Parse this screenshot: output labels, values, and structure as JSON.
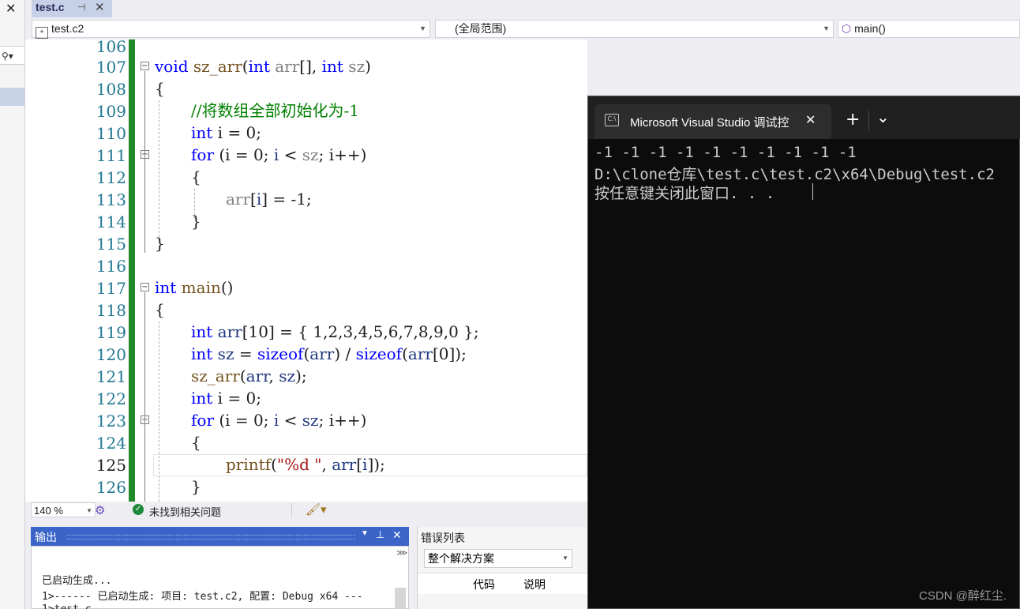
{
  "tabs": [
    {
      "name": "test.c",
      "pin": "⊣",
      "close": "✕"
    }
  ],
  "left_panel": {
    "close": "✕",
    "search_icon": "⚲▾"
  },
  "nav": {
    "project": "test.c2",
    "scope": "(全局范围)",
    "member": "main()"
  },
  "line_numbers": [
    "106",
    "107",
    "108",
    "109",
    "110",
    "111",
    "112",
    "113",
    "114",
    "115",
    "116",
    "117",
    "118",
    "119",
    "120",
    "121",
    "122",
    "123",
    "124",
    "125",
    "126"
  ],
  "code": {
    "l107": [
      "void",
      " sz_arr",
      "(",
      "int",
      " arr",
      "[], ",
      "int",
      " sz",
      ")"
    ],
    "l108": "{",
    "l109": "//将数组全部初始化为-1",
    "l110": [
      "int",
      " i = 0;"
    ],
    "l111": [
      "for",
      " (i = 0; ",
      "i",
      " < ",
      "sz",
      "; ",
      "i",
      "++)"
    ],
    "l112": "{",
    "l113": [
      "arr",
      "[",
      "i",
      "] = -1;"
    ],
    "l114": "}",
    "l115": "}",
    "l117": [
      "int",
      " main",
      "()"
    ],
    "l118": "{",
    "l119": [
      "int",
      " arr",
      "[10] = { 1,2,3,4,5,6,7,8,9,0 };"
    ],
    "l120": [
      "int",
      " sz",
      " = ",
      "sizeof",
      "(",
      "arr",
      ") / ",
      "sizeof",
      "(",
      "arr",
      "[0]);"
    ],
    "l121": [
      "sz_arr",
      "(",
      "arr",
      ", ",
      "sz",
      ");"
    ],
    "l122": [
      "int",
      " i = 0;"
    ],
    "l123": [
      "for",
      " (i = 0; ",
      "i",
      " < ",
      "sz",
      "; ",
      "i",
      "++)"
    ],
    "l124": "{",
    "l125": [
      "printf",
      "(",
      "\"%d \"",
      ", ",
      "arr",
      "[",
      "i",
      "]);"
    ],
    "l126": "}"
  },
  "status": {
    "zoom": "140 %",
    "issues": "未找到相关问题"
  },
  "output_panel": {
    "title": "输出",
    "lines": [
      "已启动生成...",
      "1>------ 已启动生成: 项目: test.c2, 配置: Debug x64 ---",
      "1>test.c"
    ]
  },
  "error_panel": {
    "title": "错误列表",
    "scope": "整个解决方案",
    "col_code": "代码",
    "col_desc": "说明"
  },
  "console": {
    "title": "Microsoft Visual Studio 调试控",
    "close": "✕",
    "new_tab": "+",
    "dropdown": "⌄",
    "lines": [
      "-1 -1 -1 -1 -1 -1 -1 -1 -1 -1",
      "D:\\clone仓库\\test.c\\test.c2\\x64\\Debug\\test.c2",
      "按任意键关闭此窗口. . ."
    ]
  },
  "watermark": "CSDN @醉红尘."
}
